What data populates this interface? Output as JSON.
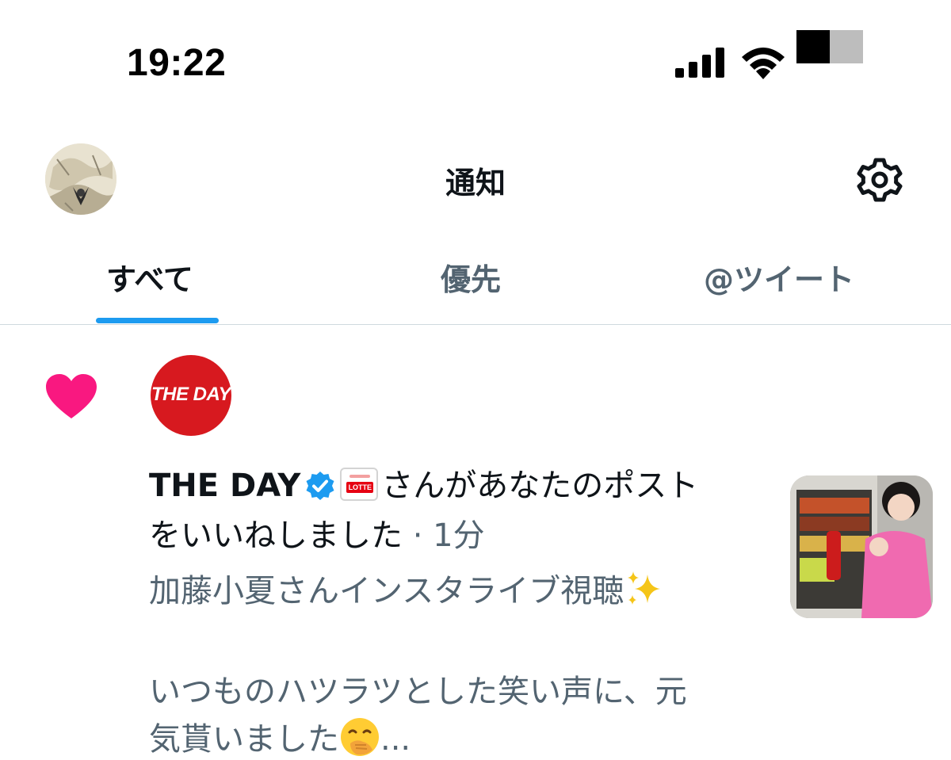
{
  "status_bar": {
    "time": "19:22"
  },
  "header": {
    "title": "通知",
    "settings_icon": "gear-icon"
  },
  "tabs": [
    {
      "label": "すべて",
      "active": true
    },
    {
      "label": "優先",
      "active": false
    },
    {
      "label": "@ツイート",
      "active": false
    }
  ],
  "colors": {
    "accent": "#1d9bf0",
    "like": "#f91880",
    "brand_red": "#d7191f",
    "secondary_text": "#536471"
  },
  "notification": {
    "type_icon": "heart-icon",
    "actor_logo_text": "THE DAY",
    "actor_name": "THE DAY",
    "badge_text": "LOTTE",
    "action_part1": "さんがあなたのポスト",
    "action_part2": "をいいねしました",
    "time_separator": " · ",
    "time": "1分",
    "excerpt_line1": "加藤小夏さんインスタライブ視聴",
    "excerpt_line2": "いつものハツラツとした笑い声に、元",
    "excerpt_line3": "気貰いました",
    "ellipsis": "..."
  }
}
